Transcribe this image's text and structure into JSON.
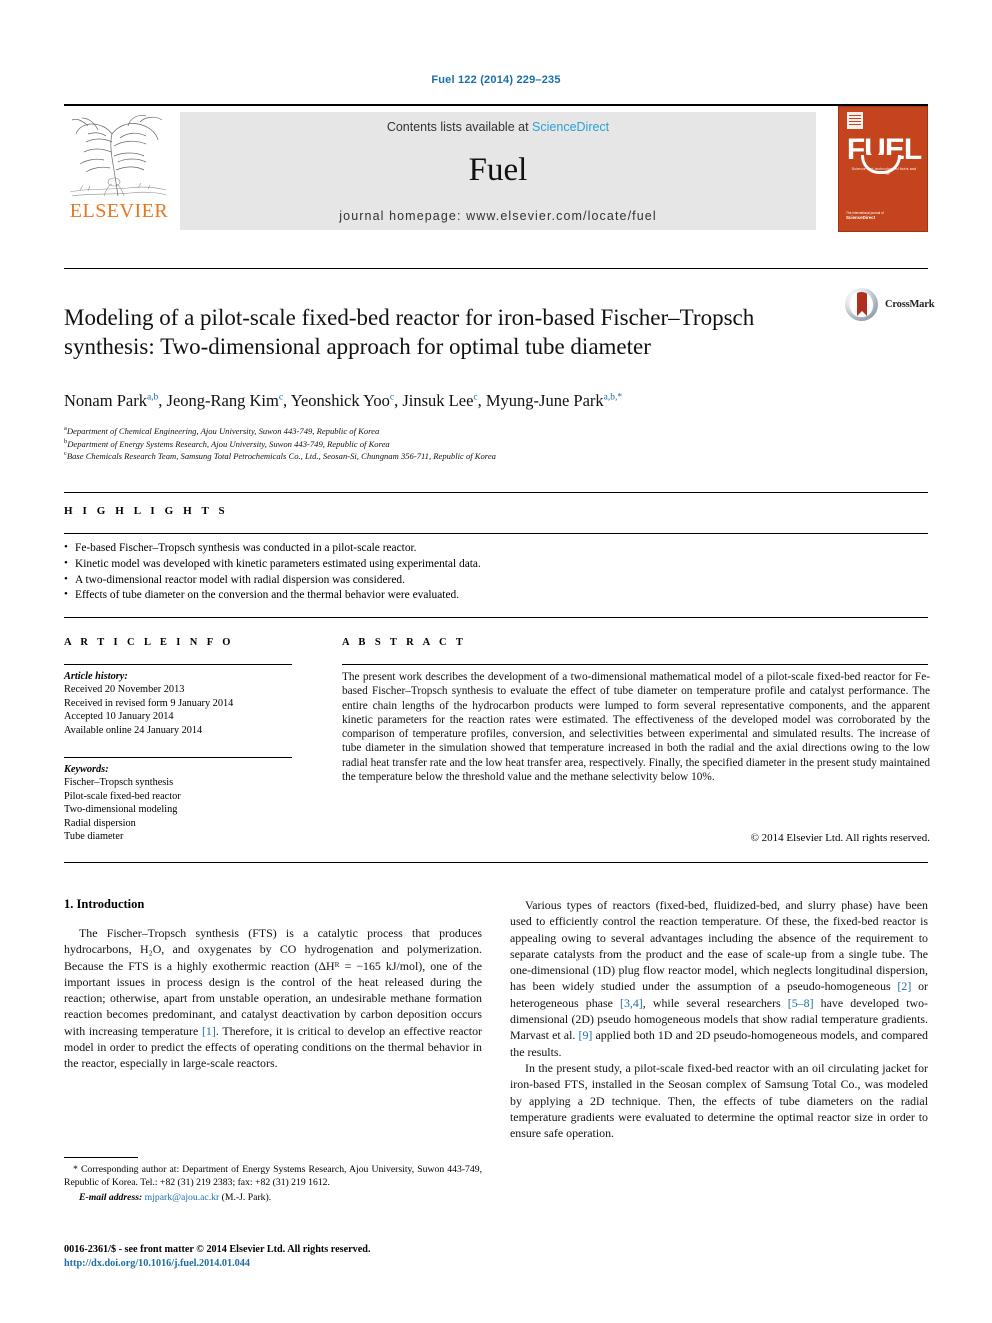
{
  "running_head": "Fuel 122 (2014) 229–235",
  "masthead": {
    "publisher_wordmark": "ELSEVIER",
    "contents_prefix": "Contents lists available at",
    "sciencedirect": "ScienceDirect",
    "journal_name": "Fuel",
    "homepage": "journal homepage: www.elsevier.com/locate/fuel",
    "cover": {
      "wordmark": "FUEL",
      "subtitle": "Science and technology of fuels and energy",
      "footer_small": "The international journal of",
      "footer_bold": "ScienceDirect"
    },
    "colors": {
      "link": "#2e9fd4",
      "elsevier_orange": "#E87722",
      "cover_orange": "#c4441d",
      "band_gray": "#e6e6e6"
    }
  },
  "title": "Modeling of a pilot-scale fixed-bed reactor for iron-based Fischer–Tropsch synthesis: Two-dimensional approach for optimal tube diameter",
  "crossmark": {
    "label": "CrossMark"
  },
  "authors": [
    {
      "name": "Nonam Park",
      "sup": "a,b"
    },
    {
      "name": "Jeong-Rang Kim",
      "sup": "c"
    },
    {
      "name": "Yeonshick Yoo",
      "sup": "c"
    },
    {
      "name": "Jinsuk Lee",
      "sup": "c"
    },
    {
      "name": "Myung-June Park",
      "sup": "a,b,*"
    }
  ],
  "affiliations": [
    {
      "marker": "a",
      "text": "Department of Chemical Engineering, Ajou University, Suwon 443-749, Republic of Korea"
    },
    {
      "marker": "b",
      "text": "Department of Energy Systems Research, Ajou University, Suwon 443-749, Republic of Korea"
    },
    {
      "marker": "c",
      "text": "Base Chemicals Research Team, Samsung Total Petrochemicals Co., Ltd., Seosan-Si, Chungnam 356-711, Republic of Korea"
    }
  ],
  "highlights": {
    "heading": "H I G H L I G H T S",
    "items": [
      "Fe-based Fischer–Tropsch synthesis was conducted in a pilot-scale reactor.",
      "Kinetic model was developed with kinetic parameters estimated using experimental data.",
      "A two-dimensional reactor model with radial dispersion was considered.",
      "Effects of tube diameter on the conversion and the thermal behavior were evaluated."
    ]
  },
  "article_info": {
    "heading": "A R T I C L E   I N F O",
    "history_label": "Article history:",
    "history": [
      "Received 20 November 2013",
      "Received in revised form 9 January 2014",
      "Accepted 10 January 2014",
      "Available online 24 January 2014"
    ],
    "keywords_label": "Keywords:",
    "keywords": [
      "Fischer–Tropsch synthesis",
      "Pilot-scale fixed-bed reactor",
      "Two-dimensional modeling",
      "Radial dispersion",
      "Tube diameter"
    ]
  },
  "abstract": {
    "heading": "A B S T R A C T",
    "text": "The present work describes the development of a two-dimensional mathematical model of a pilot-scale fixed-bed reactor for Fe-based Fischer–Tropsch synthesis to evaluate the effect of tube diameter on temperature profile and catalyst performance. The entire chain lengths of the hydrocarbon products were lumped to form several representative components, and the apparent kinetic parameters for the reaction rates were estimated. The effectiveness of the developed model was corroborated by the comparison of temperature profiles, conversion, and selectivities between experimental and simulated results. The increase of tube diameter in the simulation showed that temperature increased in both the radial and the axial directions owing to the low radial heat transfer rate and the low heat transfer area, respectively. Finally, the specified diameter in the present study maintained the temperature below the threshold value and the methane selectivity below 10%.",
    "copyright": "© 2014 Elsevier Ltd. All rights reserved."
  },
  "body": {
    "section_heading": "1. Introduction",
    "left_paragraphs": [
      "The Fischer–Tropsch synthesis (FTS) is a catalytic process that produces hydrocarbons, H₂O, and oxygenates by CO hydrogenation and polymerization. Because the FTS is a highly exothermic reaction (ΔHᴿ = −165 kJ/mol), one of the important issues in process design is the control of the heat released during the reaction; otherwise, apart from unstable operation, an undesirable methane formation reaction becomes predominant, and catalyst deactivation by carbon deposition occurs with increasing temperature [1]. Therefore, it is critical to develop an effective reactor model in order to predict the effects of operating conditions on the thermal behavior in the reactor, especially in large-scale reactors."
    ],
    "right_paragraphs": [
      "Various types of reactors (fixed-bed, fluidized-bed, and slurry phase) have been used to efficiently control the reaction temperature. Of these, the fixed-bed reactor is appealing owing to several advantages including the absence of the requirement to separate catalysts from the product and the ease of scale-up from a single tube. The one-dimensional (1D) plug flow reactor model, which neglects longitudinal dispersion, has been widely studied under the assumption of a pseudo-homogeneous [2] or heterogeneous phase [3,4], while several researchers [5–8] have developed two-dimensional (2D) pseudo homogeneous models that show radial temperature gradients. Marvast et al. [9] applied both 1D and 2D pseudo-homogeneous models, and compared the results.",
      "In the present study, a pilot-scale fixed-bed reactor with an oil circulating jacket for iron-based FTS, installed in the Seosan complex of Samsung Total Co., was modeled by applying a 2D technique. Then, the effects of tube diameters on the radial temperature gradients were evaluated to determine the optimal reactor size in order to ensure safe operation."
    ]
  },
  "footnote": {
    "corresponding": "* Corresponding author at: Department of Energy Systems Research, Ajou University, Suwon 443-749, Republic of Korea. Tel.: +82 (31) 219 2383; fax: +82 (31) 219 1612.",
    "email_label": "E-mail address:",
    "email": "mjpark@ajou.ac.kr",
    "email_suffix": "(M.-J. Park)."
  },
  "imprint": {
    "line1": "0016-2361/$ - see front matter © 2014 Elsevier Ltd. All rights reserved.",
    "doi": "http://dx.doi.org/10.1016/j.fuel.2014.01.044"
  }
}
